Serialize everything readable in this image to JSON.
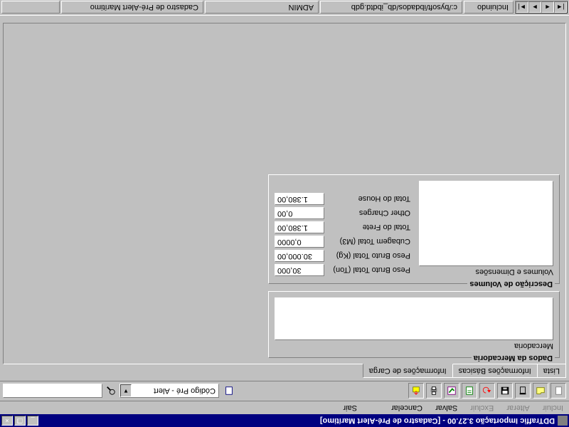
{
  "window": {
    "title": "DDTraffic Importação 3.27.00 - [Cadastro de Pré-Alert Marítimo]",
    "minimize": "_",
    "maximize": "❐",
    "close": "×"
  },
  "menu": {
    "incluir": "Incluir",
    "alterar": "Alterar",
    "excluir": "Excluir",
    "salvar": "Salvar",
    "cancelar": "Cancelar",
    "sair": "Sair"
  },
  "toolbar": {
    "combo_label": "Código Pré - Alert",
    "search_value": ""
  },
  "tabs": {
    "t1": "Lista",
    "t2": "Informações Básicas",
    "t3": "Informações de Carga"
  },
  "group_merc": {
    "title": "Dados da Mercadoria",
    "label": "Mercadoria"
  },
  "group_vol": {
    "title": "Descrição de Volumes",
    "label": "Volumes e Dimensões",
    "fields": {
      "peso_ton_label": "Peso Bruto Total (Ton)",
      "peso_ton_val": "30,000",
      "peso_kg_label": "Peso Bruto Total (Kg)",
      "peso_kg_val": "30.000,00",
      "cubagem_label": "Cubagem Total (M3)",
      "cubagem_val": "0,0000",
      "frete_label": "Total do Frete",
      "frete_val": "1.380,00",
      "other_label": "Other Charges",
      "other_val": "0,00",
      "house_label": "Total do House",
      "house_val": "1.380,00"
    }
  },
  "status": {
    "mode": "Incluindo",
    "path": "c:/bysoft/ibdados/db_ibdtd.gdb",
    "user": "ADMIN",
    "module": "Cadastro de Pré-Alert Marítimo"
  }
}
